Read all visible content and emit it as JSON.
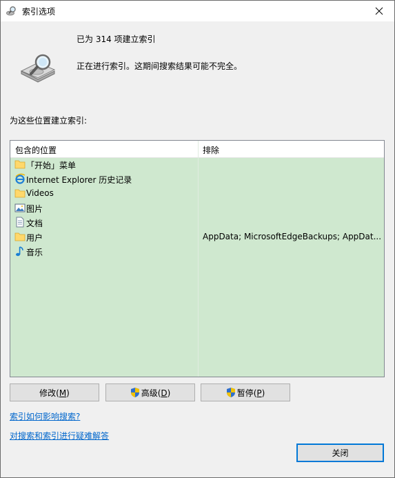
{
  "window": {
    "title": "索引选项",
    "close_label": "关闭"
  },
  "status": {
    "indexed_count": "已为 314 项建立索引",
    "progress_message": "正在进行索引。这期间搜索结果可能不完全。"
  },
  "locations": {
    "label": "为这些位置建立索引:",
    "headers": {
      "included": "包含的位置",
      "exclude": "排除"
    },
    "rows": [
      {
        "name": "「开始」菜单",
        "exclude": "",
        "icon": "folder-icon"
      },
      {
        "name": "Internet Explorer 历史记录",
        "exclude": "",
        "icon": "ie-icon"
      },
      {
        "name": "Videos",
        "exclude": "",
        "icon": "folder-icon"
      },
      {
        "name": "图片",
        "exclude": "",
        "icon": "pictures-icon"
      },
      {
        "name": "文档",
        "exclude": "",
        "icon": "documents-icon"
      },
      {
        "name": "用户",
        "exclude": "AppData; MicrosoftEdgeBackups; AppDat...",
        "icon": "folder-icon"
      },
      {
        "name": "音乐",
        "exclude": "",
        "icon": "music-icon"
      }
    ]
  },
  "buttons": {
    "modify": {
      "text": "修改(",
      "key": "M",
      "end": ")"
    },
    "advanced": {
      "text": "高级(",
      "key": "D",
      "end": ")"
    },
    "pause": {
      "text": "暂停(",
      "key": "P",
      "end": ")"
    }
  },
  "links": {
    "how_affects": "索引如何影响搜索?",
    "troubleshoot": "对搜索和索引进行疑难解答"
  },
  "colors": {
    "list_bg": "#cfe8cf",
    "link": "#0066cc",
    "default_button_border": "#0078d7"
  }
}
